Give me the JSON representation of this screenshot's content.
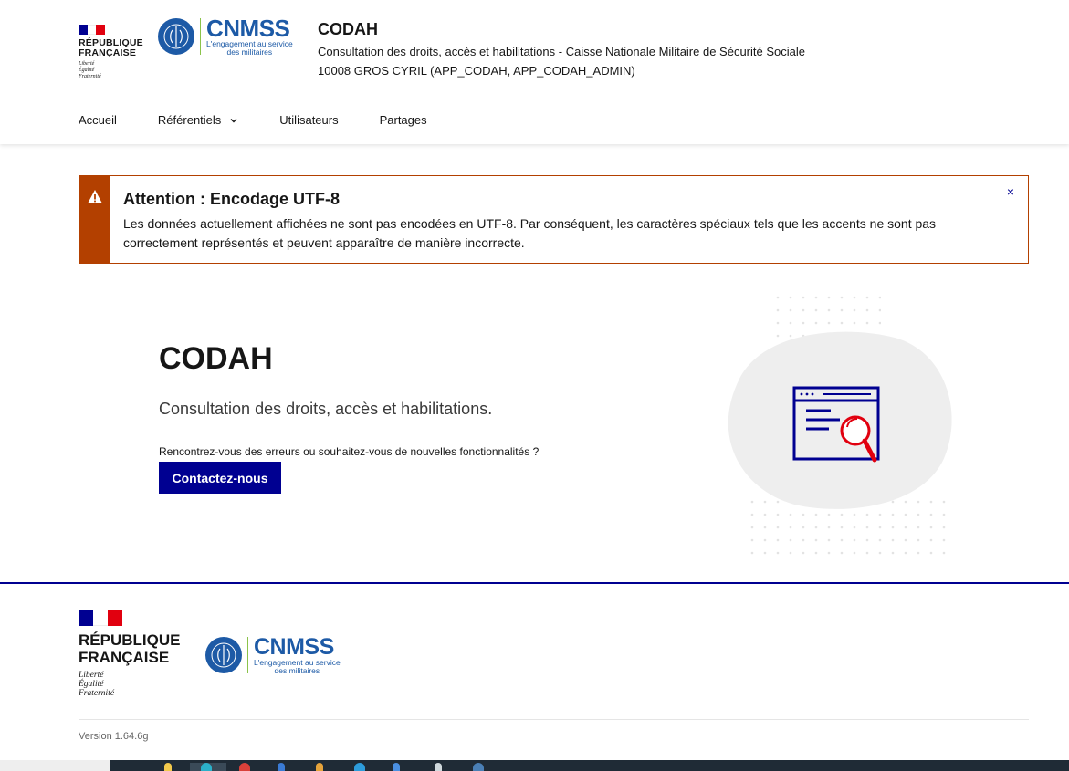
{
  "header": {
    "republique": [
      "RÉPUBLIQUE",
      "FRANÇAISE"
    ],
    "devise": [
      "Liberté",
      "Égalité",
      "Fraternité"
    ],
    "cnmss": {
      "name": "CNMSS",
      "tagline_1": "L'engagement au service",
      "tagline_2": "des militaires"
    },
    "service_title": "CODAH",
    "service_tagline": "Consultation des droits, accès et habilitations - Caisse Nationale Militaire de Sécurité Sociale",
    "user": "10008 GROS CYRIL (APP_CODAH, APP_CODAH_ADMIN)"
  },
  "nav": {
    "items": [
      {
        "label": "Accueil"
      },
      {
        "label": "Référentiels"
      },
      {
        "label": "Utilisateurs"
      },
      {
        "label": "Partages"
      }
    ]
  },
  "alert": {
    "title": "Attention : Encodage UTF-8",
    "text": "Les données actuellement affichées ne sont pas encodées en UTF-8. Par conséquent, les caractères spéciaux tels que les accents ne sont pas correctement représentés et peuvent apparaître de manière incorrecte.",
    "close": "×",
    "color": "#b34000"
  },
  "hero": {
    "title": "CODAH",
    "subtitle": "Consultation des droits, accès et habilitations.",
    "question": "Rencontrez-vous des erreurs ou souhaitez-vous de nouvelles fonctionnalités ?",
    "button": "Contactez-nous"
  },
  "footer": {
    "version": "Version 1.64.6g"
  },
  "colors": {
    "primary": "#000091",
    "cnmss_blue": "#1d5aa6",
    "warning": "#b34000",
    "illustration_red": "#e1000f"
  }
}
